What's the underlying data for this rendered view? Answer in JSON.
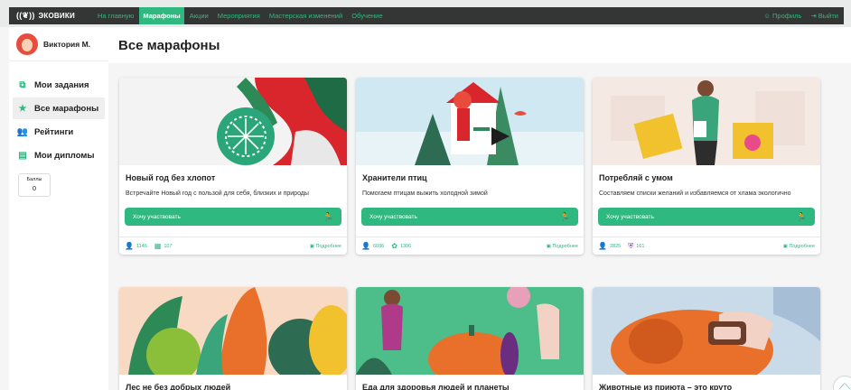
{
  "app": {
    "logo": "ЭКОВИКИ",
    "logo_icon": "leaf-signal-icon"
  },
  "nav": {
    "items": [
      "На главную",
      "Марафоны",
      "Акции",
      "Мероприятия",
      "Мастерская изменений",
      "Обучение"
    ],
    "active": "Марафоны"
  },
  "top_right": {
    "profile": "Профиль",
    "logout": "Выйти"
  },
  "user": {
    "name": "Виктория М."
  },
  "sidebar": {
    "items": [
      "Мои задания",
      "Все марафоны",
      "Рейтинги",
      "Мои дипломы"
    ],
    "active": "Все марафоны"
  },
  "points": {
    "label": "Баллы",
    "value": "0"
  },
  "page": {
    "title": "Все марафоны"
  },
  "cards": [
    {
      "title": "Новый год без хлопот",
      "desc": "Встречайте Новый год с пользой для себя, близких и природы",
      "join": "Хочу участвовать",
      "participants": "1146",
      "secondary": "107",
      "more": "Подробнее"
    },
    {
      "title": "Хранители птиц",
      "desc": "Помогаем птицам выжить холодной зимой",
      "join": "Хочу участвовать",
      "participants": "6036",
      "secondary": "1306",
      "more": "Подробнее"
    },
    {
      "title": "Потребляй с умом",
      "desc": "Составляем списки желаний и избавляемся от хлама экологично",
      "join": "Хочу участвовать",
      "participants": "2825",
      "secondary": "161",
      "more": "Подробнее"
    },
    {
      "title": "Лес не без добрых людей"
    },
    {
      "title": "Еда для здоровья людей и планеты"
    },
    {
      "title": "Животные из приюта – это круто"
    }
  ],
  "colors": {
    "accent": "#2fb880",
    "topbar": "#343635"
  }
}
